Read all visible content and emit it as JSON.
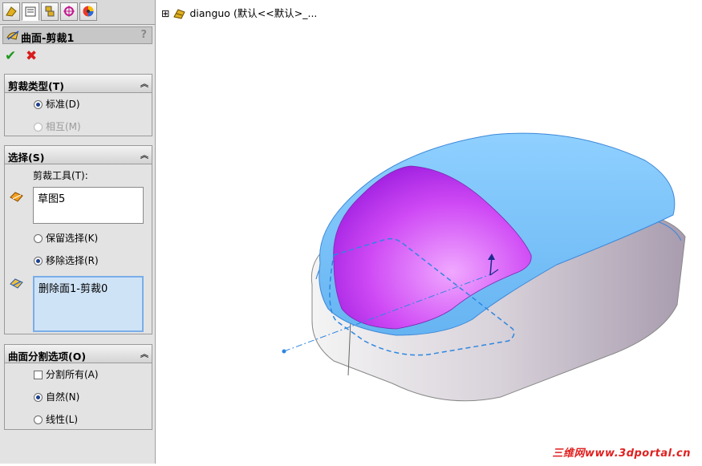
{
  "tabs": [
    "feature-manager-tab",
    "property-manager-tab",
    "configuration-manager-tab",
    "dimxpert-tab",
    "display-manager-tab"
  ],
  "feature": {
    "title": "曲面-剪裁1",
    "help": "?"
  },
  "actions": {
    "ok": "✔",
    "cancel": "✖"
  },
  "trim_type": {
    "header": "剪裁类型(T)",
    "options": [
      {
        "label": "标准(D)",
        "selected": true,
        "enabled": true
      },
      {
        "label": "相互(M)",
        "selected": false,
        "enabled": false
      }
    ]
  },
  "selection": {
    "header": "选择(S)",
    "tool_label": "剪裁工具(T):",
    "tool_value": "草图5",
    "options": [
      {
        "label": "保留选择(K)",
        "selected": false
      },
      {
        "label": "移除选择(R)",
        "selected": true
      }
    ],
    "removed_value": "删除面1-剪裁0"
  },
  "split_options": {
    "header": "曲面分割选项(O)",
    "split_all": {
      "label": "分割所有(A)",
      "checked": false
    },
    "options": [
      {
        "label": "自然(N)",
        "selected": true
      },
      {
        "label": "线性(L)",
        "selected": false
      }
    ]
  },
  "tree": {
    "expander": "⊞",
    "part_name": "dianguo",
    "config": "(默认<<默认>_..."
  },
  "watermark": "三维网www.3dportal.cn",
  "colors": {
    "top_surface": "#7cc4f7",
    "inner_surface": "#c23ef0",
    "body": "#c9c0cc",
    "sketch": "#2e86e0"
  }
}
